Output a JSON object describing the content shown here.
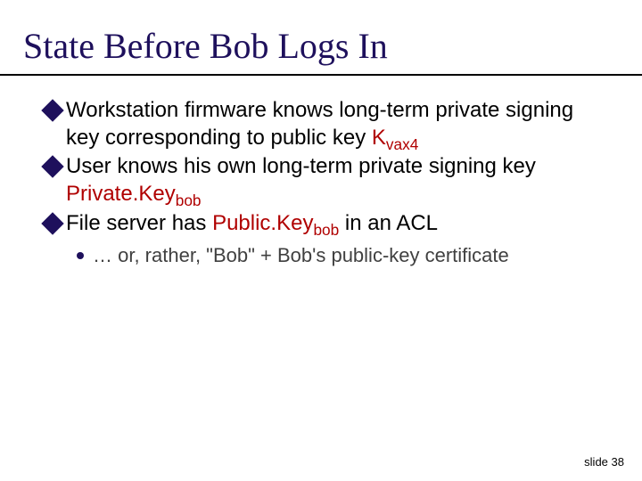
{
  "title": "State Before Bob Logs In",
  "bullets": {
    "b1": {
      "t1": "Workstation firmware knows long-term private signing key corresponding to public key ",
      "k1": "K",
      "s1": "vax4"
    },
    "b2": {
      "t1": "User knows his own long-term private signing key ",
      "k1": "Private.Key",
      "s1": "bob"
    },
    "b3": {
      "t1": "File server has ",
      "k1": "Public.Key",
      "s1": "bob",
      "t2": " in an ACL"
    },
    "sub1": "… or, rather, \"Bob\" + Bob's public-key certificate"
  },
  "footer": {
    "label": "slide ",
    "num": "38"
  }
}
